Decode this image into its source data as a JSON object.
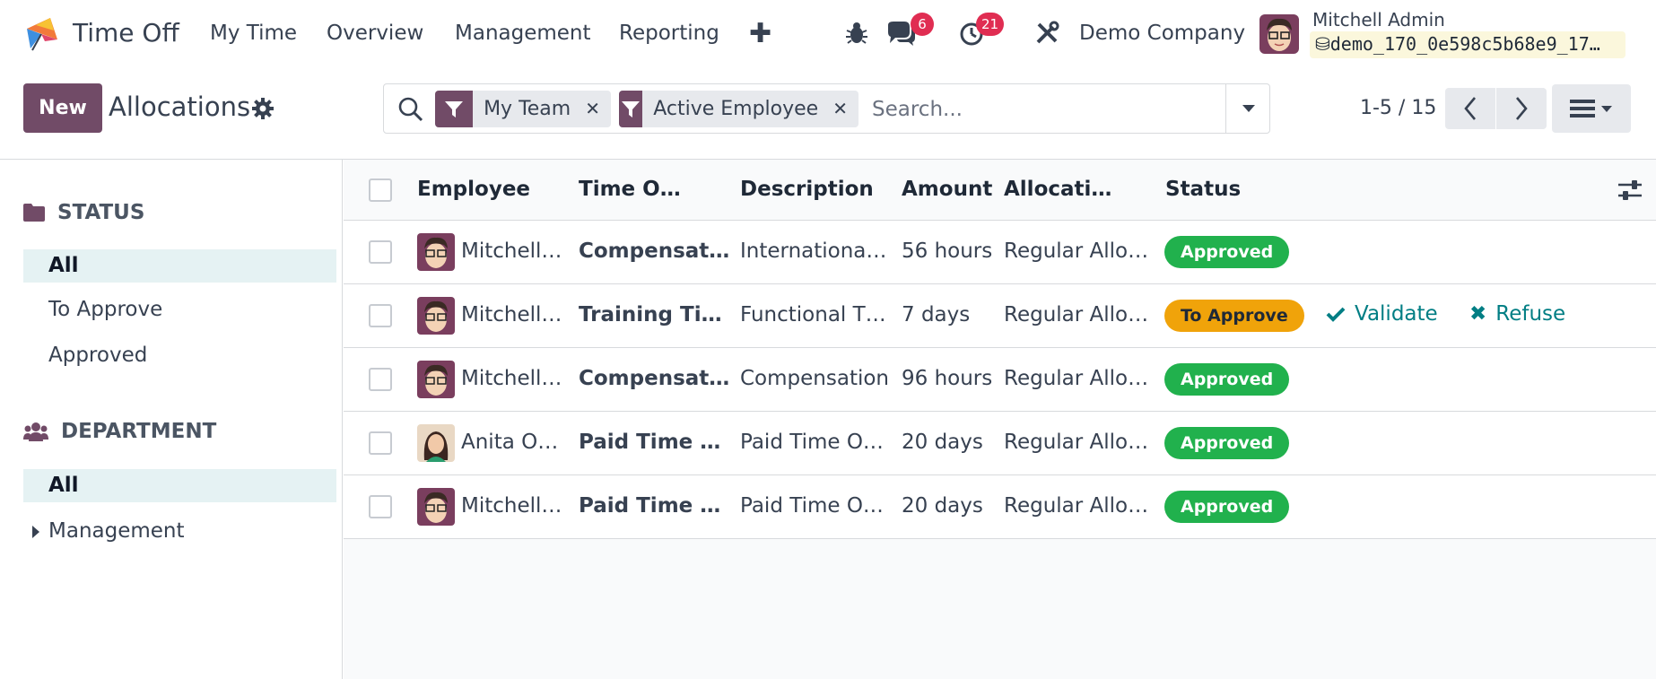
{
  "navbar": {
    "app_title": "Time Off",
    "menu": [
      "My Time",
      "Overview",
      "Management",
      "Reporting"
    ],
    "messages_count": "6",
    "activities_count": "21",
    "company": "Demo Company",
    "user_name": "Mitchell Admin",
    "database": "demo_170_0e598c5b68e9_17…"
  },
  "control": {
    "new_label": "New",
    "title": "Allocations",
    "facets": [
      "My Team",
      "Active Employee"
    ],
    "search_placeholder": "Search...",
    "pager": "1-5 / 15"
  },
  "sidebar": {
    "status_title": "STATUS",
    "status_items": [
      "All",
      "To Approve",
      "Approved"
    ],
    "department_title": "DEPARTMENT",
    "department_items": [
      "All",
      "Management"
    ]
  },
  "list": {
    "columns": [
      "Employee",
      "Time O…",
      "Description",
      "Amount",
      "Allocati…",
      "Status"
    ],
    "rows": [
      {
        "employee": "Mitchell…",
        "time_off": "Compensat…",
        "description": "Internationa…",
        "amount": "56 hours",
        "allocation": "Regular Allo…",
        "status": "Approved"
      },
      {
        "employee": "Mitchell…",
        "time_off": "Training Ti…",
        "description": "Functional T…",
        "amount": "7 days",
        "allocation": "Regular Allo…",
        "status": "To Approve",
        "validate": "Validate",
        "refuse": "Refuse"
      },
      {
        "employee": "Mitchell…",
        "time_off": "Compensat…",
        "description": "Compensation",
        "amount": "96 hours",
        "allocation": "Regular Allo…",
        "status": "Approved"
      },
      {
        "employee": "Anita O…",
        "time_off": "Paid Time Off",
        "description": "Paid Time O…",
        "amount": "20 days",
        "allocation": "Regular Allo…",
        "status": "Approved"
      },
      {
        "employee": "Mitchell…",
        "time_off": "Paid Time Off",
        "description": "Paid Time O…",
        "amount": "20 days",
        "allocation": "Regular Allo…",
        "status": "Approved"
      }
    ]
  },
  "colors": {
    "brand": "#714b67",
    "approved": "#21b14d",
    "to_approve": "#f0a30a",
    "action": "#017e84",
    "badge": "#e02d52"
  },
  "icons": [
    "app-logo-icon",
    "plus-icon",
    "bug-icon",
    "chat-icon",
    "clock-icon",
    "tools-icon",
    "database-icon",
    "gear-icon",
    "search-icon",
    "filter-icon",
    "close-icon",
    "caret-down-icon",
    "chevron-left-icon",
    "chevron-right-icon",
    "list-view-icon",
    "folder-icon",
    "users-icon",
    "check-icon",
    "optional-columns-icon"
  ]
}
